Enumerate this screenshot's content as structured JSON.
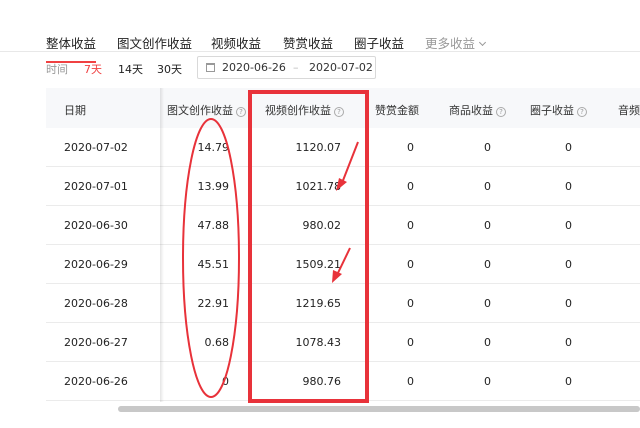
{
  "tabs": [
    {
      "label": "整体收益"
    },
    {
      "label": "图文创作收益"
    },
    {
      "label": "视频收益"
    },
    {
      "label": "赞赏收益"
    },
    {
      "label": "圈子收益"
    },
    {
      "label": "更多收益"
    }
  ],
  "filter": {
    "label": "时间",
    "ranges": [
      "7天",
      "14天",
      "30天"
    ],
    "active_range": "7天",
    "date_start": "2020-06-26",
    "date_sep": "–",
    "date_end": "2020-07-02"
  },
  "table": {
    "columns": [
      "日期",
      "图文创作收益",
      "视频创作收益",
      "赞赏金额",
      "商品收益",
      "圈子收益",
      "音频"
    ],
    "help_glyph": "?",
    "rows": [
      [
        "2020-07-02",
        "14.79",
        "1120.07",
        "0",
        "0",
        "0"
      ],
      [
        "2020-07-01",
        "13.99",
        "1021.78",
        "0",
        "0",
        "0"
      ],
      [
        "2020-06-30",
        "47.88",
        "980.02",
        "0",
        "0",
        "0"
      ],
      [
        "2020-06-29",
        "45.51",
        "1509.21",
        "0",
        "0",
        "0"
      ],
      [
        "2020-06-28",
        "22.91",
        "1219.65",
        "0",
        "0",
        "0"
      ],
      [
        "2020-06-27",
        "0.68",
        "1078.43",
        "0",
        "0",
        "0"
      ],
      [
        "2020-06-26",
        "0",
        "980.76",
        "0",
        "0",
        "0"
      ]
    ]
  },
  "annotations": {
    "color": "#e8323a",
    "items": [
      "ellipse around 图文创作收益 column",
      "rectangle around 视频创作收益 column",
      "two arrows pointing into 视频创作收益 column"
    ]
  },
  "colors": {
    "accent": "#f04142",
    "header_bg": "#f7f8fa",
    "muted_text": "#999999"
  }
}
